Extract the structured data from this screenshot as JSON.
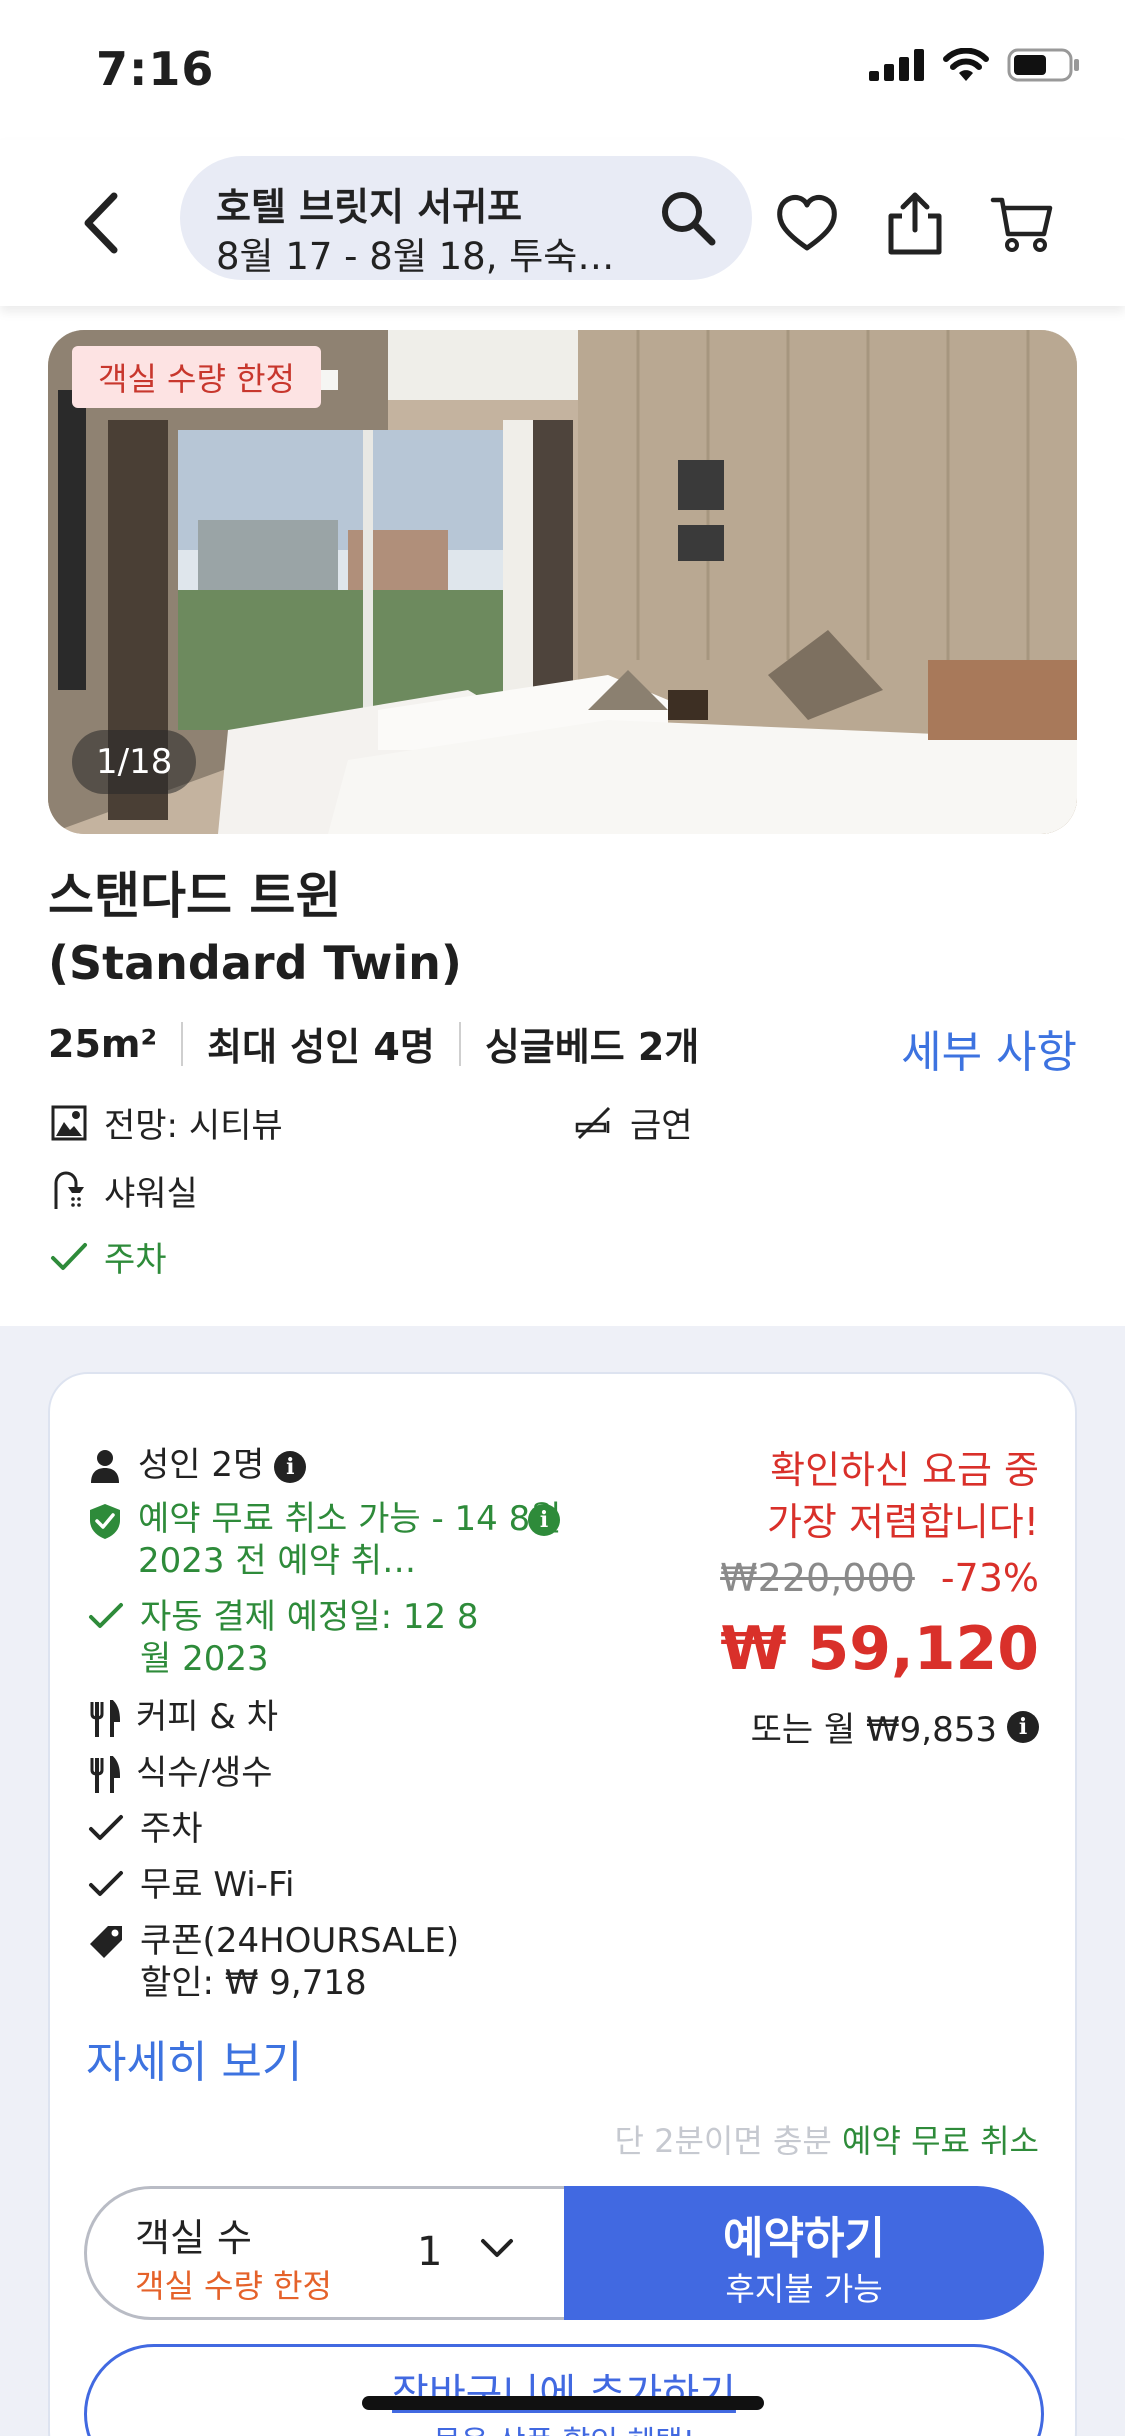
{
  "status": {
    "time": "7:16"
  },
  "header": {
    "hotel_name": "호텔 브릿지 서귀포",
    "trip_summary": "8월 17 - 8월 18, 투숙…"
  },
  "hero": {
    "badge": "객실 수량 한정",
    "photo_counter": "1/18"
  },
  "room": {
    "name_ko": "스탠다드 트윈",
    "name_en": "(Standard Twin)",
    "size": "25m²",
    "max_guests": "최대 성인 4명",
    "beds": "싱글베드 2개",
    "details_link": "세부 사항",
    "features": {
      "view": "전망: 시티뷰",
      "smoking": "금연",
      "shower": "샤워실",
      "parking": "주차"
    }
  },
  "offer": {
    "adults": "성인 2명",
    "free_cancel": "예약 무료 취소 가능 - 14 8월 2023 전 예약 취…",
    "auto_pay": "자동 결제 예정일: 12 8 월 2023",
    "coffee": "커피 & 차",
    "water": "식수/생수",
    "parking": "주차",
    "wifi": "무료 Wi-Fi",
    "coupon_line1": "쿠폰(24HOURSALE)",
    "coupon_line2": "할인: ₩ 9,718",
    "more_link": "자세히 보기",
    "promo_line1": "확인하신 요금 중",
    "promo_line2": "가장 저렴합니다!",
    "original_price": "₩220,000",
    "discount": "-73%",
    "price": "₩ 59,120",
    "monthly": "또는 월 ₩9,853",
    "note_gray": "단 2분이면 충분",
    "note_green": "예약 무료 취소"
  },
  "booking": {
    "rooms_label": "객실 수",
    "rooms_limited": "객실 수량 한정",
    "rooms_selected": "1",
    "book_label": "예약하기",
    "book_sub": "후지불 가능",
    "cart_label": "장바구니에 추가하기",
    "cart_sub": "묶음 상품 할인 혜택!"
  },
  "colors": {
    "accent_blue": "#4169e1",
    "link_blue": "#3d73e0",
    "price_red": "#d9302a",
    "green": "#2e8b3a",
    "orange": "#e5622a"
  }
}
